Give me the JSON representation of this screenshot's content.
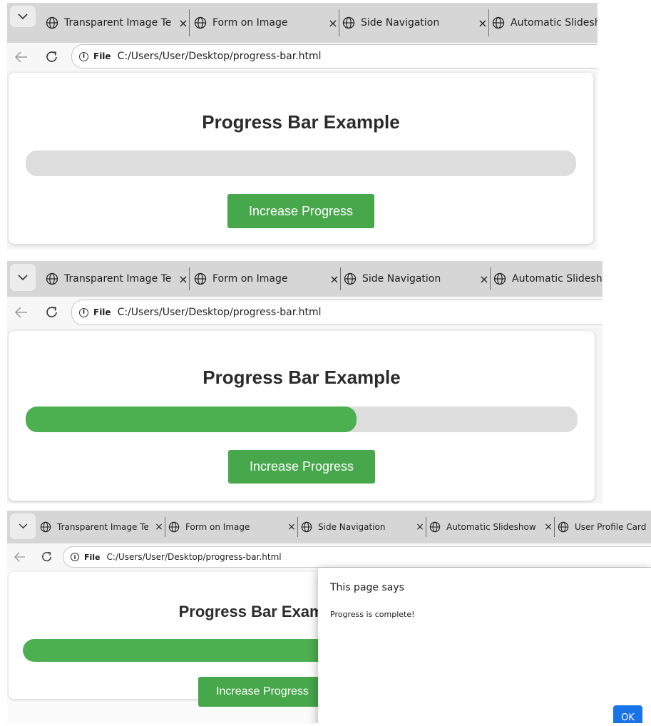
{
  "screens": [
    {
      "tabs": [
        {
          "title": "Transparent Image Te",
          "close": "×"
        },
        {
          "title": "Form on Image",
          "close": "×"
        },
        {
          "title": "Side Navigation",
          "close": "×"
        },
        {
          "title": "Automatic Slidesho",
          "close": ""
        }
      ],
      "address": {
        "file_label": "File",
        "url": "C:/Users/User/Desktop/progress-bar.html"
      },
      "page": {
        "heading": "Progress Bar Example",
        "button_label": "Increase Progress",
        "progress": 0
      }
    },
    {
      "tabs": [
        {
          "title": "Transparent Image Te",
          "close": "×"
        },
        {
          "title": "Form on Image",
          "close": "×"
        },
        {
          "title": "Side Navigation",
          "close": "×"
        },
        {
          "title": "Automatic Slidesho",
          "close": ""
        }
      ],
      "address": {
        "file_label": "File",
        "url": "C:/Users/User/Desktop/progress-bar.html"
      },
      "page": {
        "heading": "Progress Bar Example",
        "button_label": "Increase Progress",
        "progress": 0.6
      }
    },
    {
      "tabs": [
        {
          "title": "Transparent Image Te",
          "close": "×"
        },
        {
          "title": "Form on Image",
          "close": "×"
        },
        {
          "title": "Side Navigation",
          "close": "×"
        },
        {
          "title": "Automatic Slideshow",
          "close": "×"
        },
        {
          "title": "User Profile Card",
          "close": ""
        }
      ],
      "address": {
        "file_label": "File",
        "url": "C:/Users/User/Desktop/progress-bar.html"
      },
      "page": {
        "heading": "Progress Bar Example",
        "button_label": "Increase Progress",
        "progress": 1
      },
      "dialog": {
        "title": "This page says",
        "message": "Progress is complete!",
        "ok_label": "OK"
      }
    }
  ],
  "colors": {
    "progress_fill": "#4caf50",
    "progress_track": "#dddddd",
    "button": "#46a74b",
    "dialog_ok": "#1a73e8"
  }
}
